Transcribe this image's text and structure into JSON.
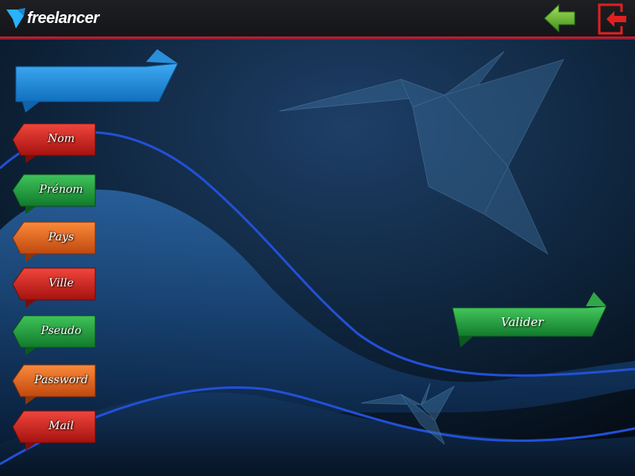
{
  "header": {
    "logo_text": "freelancer",
    "back_button_icon": "arrow-left-icon",
    "exit_button_icon": "logout-icon"
  },
  "form": {
    "title": "",
    "fields": [
      {
        "label": "Nom",
        "color": "#d8231c"
      },
      {
        "label": "Prénom",
        "color": "#1f9a3c"
      },
      {
        "label": "Pays",
        "color": "#e8621b"
      },
      {
        "label": "Ville",
        "color": "#d8231c"
      },
      {
        "label": "Pseudo",
        "color": "#1f9a3c"
      },
      {
        "label": "Password",
        "color": "#e8621b"
      },
      {
        "label": "Mail",
        "color": "#d8231c"
      }
    ],
    "submit_label": "Valider"
  },
  "colors": {
    "accent_red": "#c4253c",
    "ribbon_blue": "#1f8fdc",
    "green": "#2f9e3c"
  }
}
